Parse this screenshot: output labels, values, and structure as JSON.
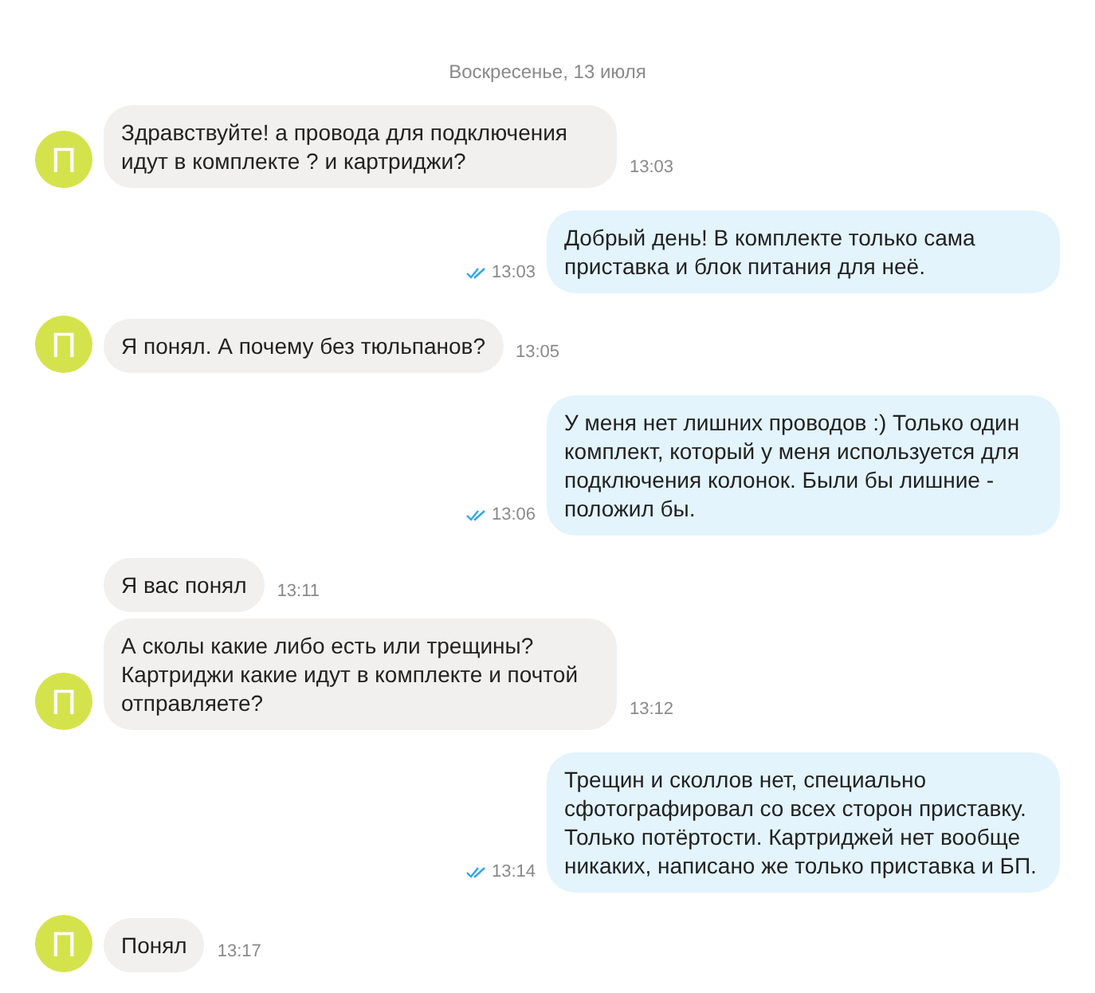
{
  "date_separator": "Воскресенье, 13 июля",
  "messages": [
    {
      "kind": "incoming",
      "text": "Здравствуйте! а провода для подключения идут в комплекте ? и картриджи?",
      "time": "13:03",
      "avatar": "П"
    },
    {
      "kind": "outgoing",
      "text": "Добрый день! В комплекте только сама приставка и блок питания для неё.",
      "time": "13:03",
      "read": true
    },
    {
      "kind": "incoming",
      "text": "Я понял. А почему без тюльпанов?",
      "time": "13:05",
      "avatar": "П"
    },
    {
      "kind": "outgoing",
      "text": "У меня нет лишних проводов :) Только один комплект, который у меня используется для подключения колонок. Были бы лишние - положил бы.",
      "time": "13:06",
      "read": true
    },
    {
      "kind": "incoming",
      "text": "Я вас понял",
      "time": "13:11"
    },
    {
      "kind": "incoming",
      "text": "А сколы какие либо есть или трещины? Картриджи какие идут в комплекте и почтой отправляете?",
      "time": "13:12",
      "avatar": "П"
    },
    {
      "kind": "outgoing",
      "text": "Трещин и сколлов нет, специально сфотографировал со всех сторон приставку. Только потёртости. Картриджей нет вообще никаких, написано же только приставка и БП.",
      "time": "13:14",
      "read": true
    },
    {
      "kind": "incoming",
      "text": "Понял",
      "time": "13:17",
      "avatar": "П"
    }
  ]
}
